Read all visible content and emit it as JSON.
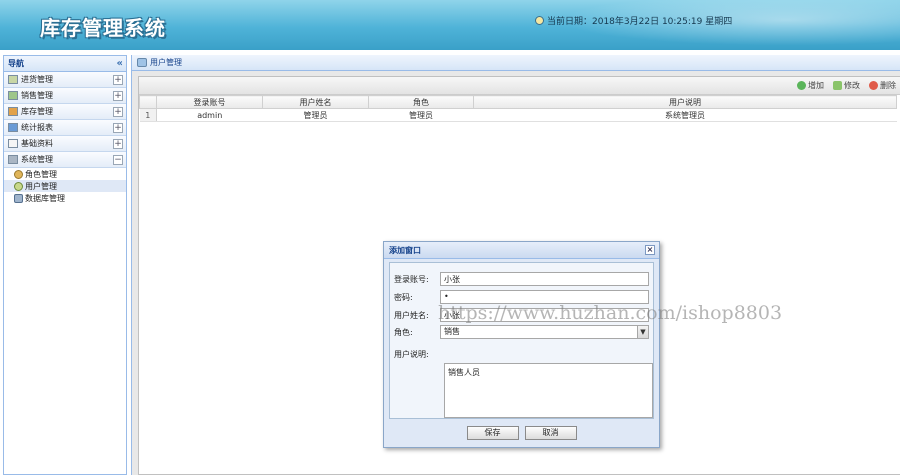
{
  "header": {
    "title": "库存管理系统",
    "date_label": "当前日期：2018年3月22日 10:25:19 星期四"
  },
  "sidebar": {
    "title": "导航",
    "collapse_glyph": "«",
    "categories": [
      {
        "label": "进货管理",
        "toggle": "+"
      },
      {
        "label": "销售管理",
        "toggle": "+"
      },
      {
        "label": "库存管理",
        "toggle": "+"
      },
      {
        "label": "统计报表",
        "toggle": "+"
      },
      {
        "label": "基础资料",
        "toggle": "+"
      },
      {
        "label": "系统管理",
        "toggle": "−"
      }
    ],
    "subitems": [
      {
        "label": "角色管理"
      },
      {
        "label": "用户管理"
      },
      {
        "label": "数据库管理"
      }
    ]
  },
  "main": {
    "tab_title": "用户管理",
    "toolbar": {
      "add": "增加",
      "edit": "修改",
      "delete": "删除"
    },
    "columns": [
      "登录账号",
      "用户姓名",
      "角色",
      "用户说明"
    ],
    "rows": [
      {
        "index": "1",
        "account": "admin",
        "name": "管理员",
        "role": "管理员",
        "desc": "系统管理员"
      }
    ]
  },
  "dialog": {
    "title": "添加窗口",
    "close_glyph": "×",
    "fields": {
      "account": {
        "label": "登录账号:",
        "value": "小张"
      },
      "password": {
        "label": "密码:",
        "value": "•"
      },
      "username": {
        "label": "用户姓名:",
        "value": "小张"
      },
      "role": {
        "label": "角色:",
        "value": "销售"
      },
      "desc": {
        "label": "用户说明:",
        "value": "销售人员"
      }
    },
    "save": "保存",
    "cancel": "取消"
  },
  "watermark": "https://www.huzhan.com/ishop8803",
  "colors": {
    "header": "#4fb3d8",
    "panel_border": "#99bbe8",
    "title_text": "#15428b"
  }
}
